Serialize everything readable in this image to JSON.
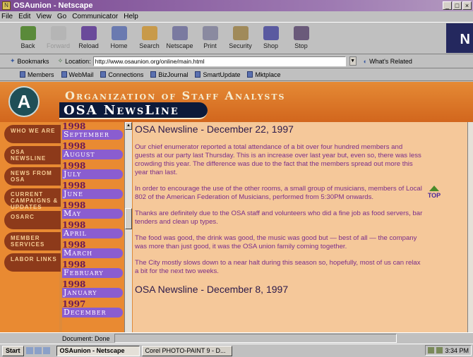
{
  "window": {
    "title": "OSAunion - Netscape",
    "buttons": [
      "_",
      "□",
      "×"
    ]
  },
  "menu": [
    "File",
    "Edit",
    "View",
    "Go",
    "Communicator",
    "Help"
  ],
  "toolbar": [
    {
      "label": "Back",
      "icon": "back-arrow-icon",
      "color": "#5a8a3a",
      "enabled": true
    },
    {
      "label": "Forward",
      "icon": "forward-arrow-icon",
      "color": "#b5b5b5",
      "enabled": false
    },
    {
      "label": "Reload",
      "icon": "reload-icon",
      "color": "#6a4a9a",
      "enabled": true
    },
    {
      "label": "Home",
      "icon": "home-icon",
      "color": "#6a7ab0",
      "enabled": true
    },
    {
      "label": "Search",
      "icon": "search-icon",
      "color": "#c89a4a",
      "enabled": true
    },
    {
      "label": "Netscape",
      "icon": "netscape-icon",
      "color": "#7a7aa0",
      "enabled": true
    },
    {
      "label": "Print",
      "icon": "print-icon",
      "color": "#8a8aa0",
      "enabled": true
    },
    {
      "label": "Security",
      "icon": "lock-icon",
      "color": "#a08a5a",
      "enabled": true
    },
    {
      "label": "Shop",
      "icon": "shop-icon",
      "color": "#5a5aa0",
      "enabled": true
    },
    {
      "label": "Stop",
      "icon": "stop-icon",
      "color": "#6a5a7a",
      "enabled": true
    }
  ],
  "location": {
    "bookmarks_label": "Bookmarks",
    "location_label": "Location:",
    "url": "http://www.osaunion.org/online/main.html",
    "whats_related": "What's Related"
  },
  "personal_toolbar": [
    "Members",
    "WebMail",
    "Connections",
    "BizJournal",
    "SmartUpdate",
    "Mktplace"
  ],
  "site": {
    "org_name": "Organization of Staff Analysts",
    "newsline": "OSA NewsLine",
    "logo_letter": "A"
  },
  "left_nav": [
    {
      "label": "WHO WE ARE"
    },
    {
      "label": "OSA NEWSLINE"
    },
    {
      "label": "NEWS FROM OSA"
    },
    {
      "label": "CURRENT CAMPAIGNS & UPDATES"
    },
    {
      "label": "OSARC"
    },
    {
      "label": "MEMBER SERVICES"
    },
    {
      "label": "LABOR LINKS"
    }
  ],
  "months": [
    {
      "year": "1998",
      "month": "September"
    },
    {
      "year": "1998",
      "month": "August"
    },
    {
      "year": "1998",
      "month": "July"
    },
    {
      "year": "1998",
      "month": "June"
    },
    {
      "year": "1998",
      "month": "May"
    },
    {
      "year": "1998",
      "month": "April"
    },
    {
      "year": "1998",
      "month": "March"
    },
    {
      "year": "1998",
      "month": "February"
    },
    {
      "year": "1998",
      "month": "January"
    },
    {
      "year": "1997",
      "month": "December"
    }
  ],
  "article": {
    "heading1": "OSA Newsline - December 22, 1997",
    "paragraphs": [
      "Our chief enumerator reported a total attendance of a bit over four hundred members and guests at our party last Thursday. This is an increase over last year but, even so, there was less crowding this year. The difference was due to the fact that the members spread out more this year than last.",
      "In order to encourage the use of the other rooms, a small group of musicians, members of Local 802 of the American Federation of Musicians, performed from 5:30PM onwards.",
      "Thanks are definitely due to the OSA staff and volunteers who did a fine job as food servers, bar tenders and clean up types.",
      "The food was good, the drink was good, the music was good but — best of all — the company was more than just good, it was the OSA union family coming together.",
      "The City mostly slows down to a near halt during this season so, hopefully, most of us can relax a bit for the next two weeks."
    ],
    "heading2": "OSA Newsline - December 8, 1997",
    "top_label": "TOP"
  },
  "status": {
    "text": "Document: Done"
  },
  "taskbar": {
    "start": "Start",
    "tasks": [
      "OSAunion - Netscape",
      "Corel PHOTO-PAINT 9 - D..."
    ],
    "clock": "3:34 PM"
  }
}
